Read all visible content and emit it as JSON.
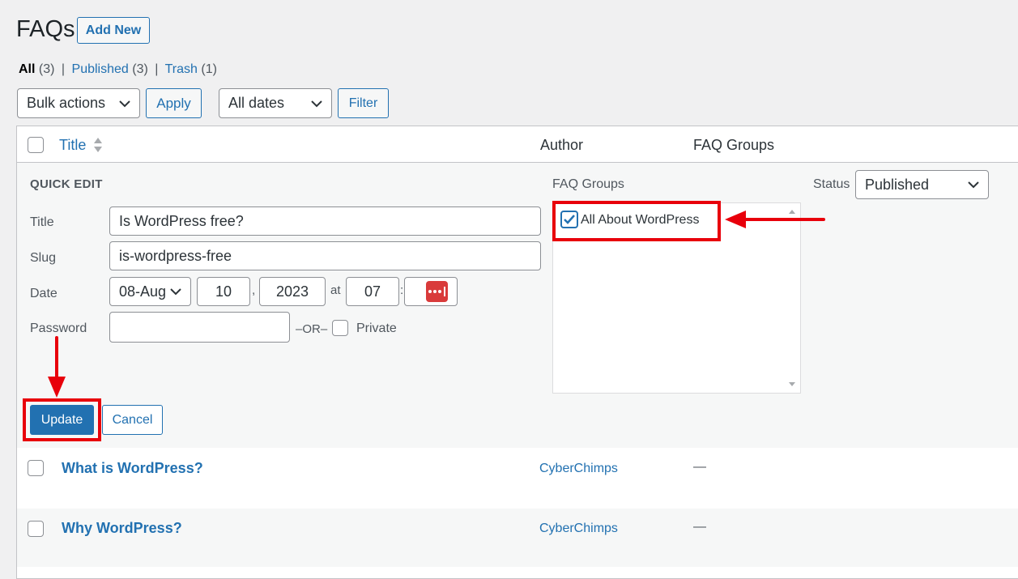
{
  "header": {
    "title": "FAQs",
    "add_new": "Add New"
  },
  "views": [
    {
      "label": "All",
      "count": "(3)"
    },
    {
      "label": "Published",
      "count": "(3)"
    },
    {
      "label": "Trash",
      "count": "(1)"
    }
  ],
  "toolbar": {
    "bulk_actions": "Bulk actions",
    "apply": "Apply",
    "dates": "All dates",
    "filter": "Filter"
  },
  "columns": {
    "title": "Title",
    "author": "Author",
    "groups": "FAQ Groups"
  },
  "quick_edit": {
    "heading": "QUICK EDIT",
    "title_label": "Title",
    "title_value": "Is WordPress free?",
    "slug_label": "Slug",
    "slug_value": "is-wordpress-free",
    "date_label": "Date",
    "month": "08-Aug",
    "day": "10",
    "comma": ",",
    "year": "2023",
    "at": "at",
    "hour": "07",
    "colon": ":",
    "password_label": "Password",
    "or": "–OR–",
    "private_label": "Private",
    "groups_label": "FAQ Groups",
    "group_item": "All About WordPress",
    "status_label": "Status",
    "status_value": "Published",
    "update": "Update",
    "cancel": "Cancel"
  },
  "rows": [
    {
      "title": "What is WordPress?",
      "author": "CyberChimps",
      "groups": "—"
    },
    {
      "title": "Why WordPress?",
      "author": "CyberChimps",
      "groups": "—"
    }
  ],
  "colors": {
    "accent": "#2271b1",
    "annotation": "#e8000b"
  }
}
